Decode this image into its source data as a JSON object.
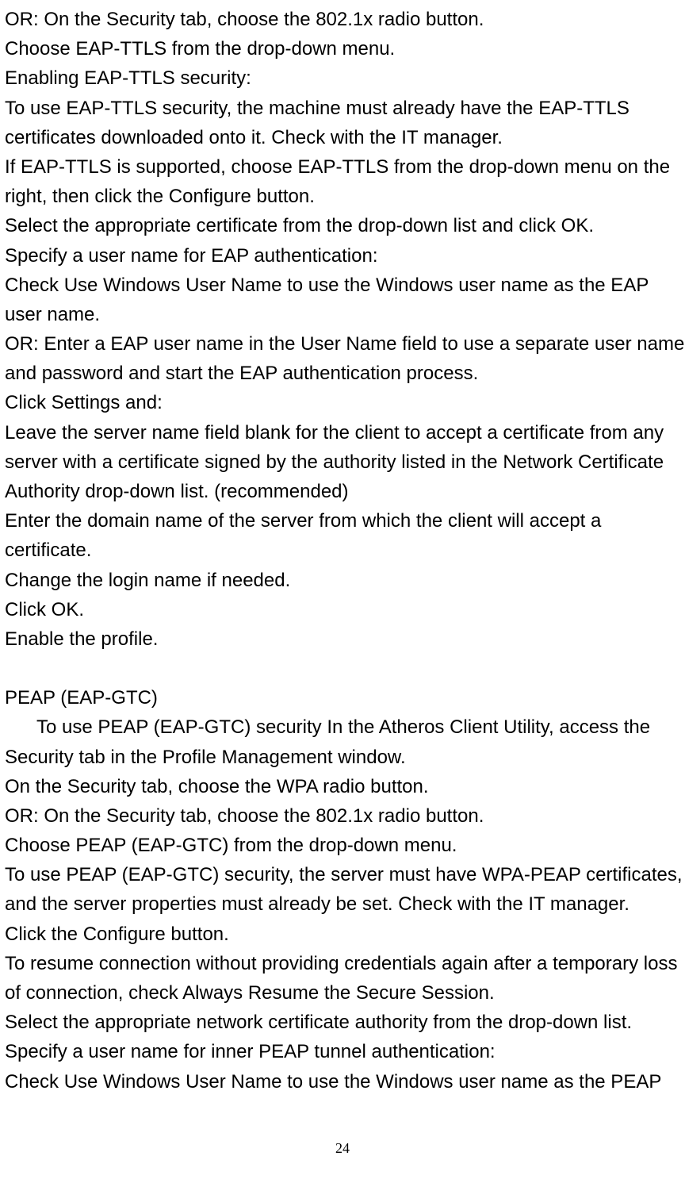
{
  "paragraphs": {
    "p1": "OR: On the Security tab, choose the 802.1x radio button.",
    "p2": "Choose EAP-TTLS from the drop-down menu.",
    "p3": "Enabling EAP-TTLS security:",
    "p4": "To use EAP-TTLS security, the machine must already have the EAP-TTLS certificates downloaded onto it. Check with the IT manager.",
    "p5": "If EAP-TTLS is supported, choose EAP-TTLS from the drop-down menu on the right, then click the Configure button.",
    "p6": "Select the appropriate certificate from the drop-down list and click OK.",
    "p7": "Specify a user name for EAP authentication:",
    "p8": "Check Use Windows User Name to use the Windows user name as the EAP user name.",
    "p9": "OR: Enter a EAP user name in the User Name field to use a separate user name and password and start the EAP authentication process.",
    "p10": "Click Settings and:",
    "p11": "Leave the server name field blank for the client to accept a certificate from any server with a certificate signed by the authority listed in the Network Certificate Authority drop-down list. (recommended)",
    "p12": "Enter the domain name of the server from which the client will accept a certificate.",
    "p13": "Change the login name if needed.",
    "p14": "Click OK.",
    "p15": "Enable the profile.",
    "p16": "PEAP (EAP-GTC)",
    "p17": "To use PEAP (EAP-GTC) security In the Atheros Client Utility, access the Security tab in the Profile Management window.",
    "p18": "On the Security tab, choose the WPA radio button.",
    "p19": "OR: On the Security tab, choose the 802.1x radio button.",
    "p20": "Choose PEAP (EAP-GTC) from the drop-down menu.",
    "p21": "To use PEAP (EAP-GTC) security, the server must have WPA-PEAP certificates, and the server properties must already be set. Check with the IT manager.",
    "p22": "Click the Configure button.",
    "p23": "To resume connection without providing credentials again after a temporary loss of connection, check Always Resume the Secure Session.",
    "p24": "Select the appropriate network certificate authority from the drop-down list.",
    "p25": "Specify a user name for inner PEAP tunnel authentication:",
    "p26": "Check Use Windows User Name to use the Windows user name as the PEAP"
  },
  "page_number": "24"
}
